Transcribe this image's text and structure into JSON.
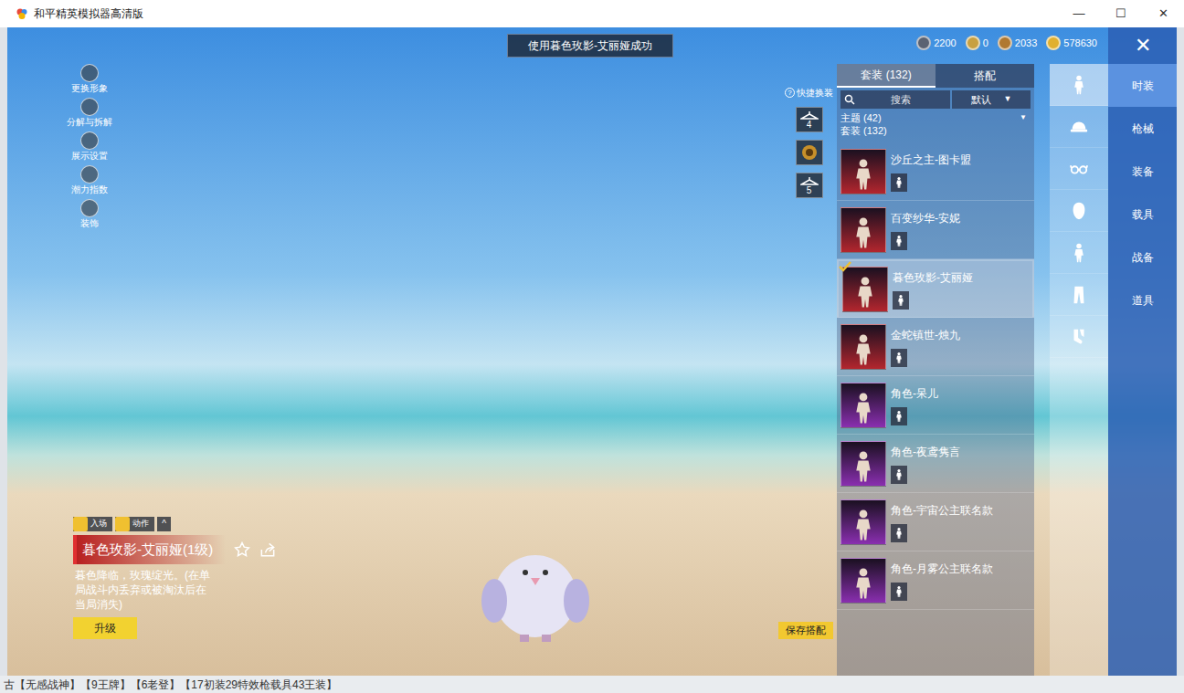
{
  "window": {
    "title": "和平精英模拟器高清版",
    "controls": [
      "—",
      "☐",
      "✕"
    ]
  },
  "toast": "使用暮色玫影-艾丽娅成功",
  "currencies": [
    {
      "amount": "2200",
      "color": "#5a6272"
    },
    {
      "amount": "0",
      "color": "#c8a040"
    },
    {
      "amount": "2033",
      "color": "#b07830"
    },
    {
      "amount": "578630",
      "color": "#e0b030"
    }
  ],
  "close_button": "✕",
  "side_menu": [
    "更换形象",
    "分解与拆解",
    "展示设置",
    "潮力指数",
    "装饰"
  ],
  "quick_change": {
    "help": "?",
    "label": "快捷换装",
    "slots": [
      {
        "kind": "hanger",
        "number": "4"
      },
      {
        "kind": "badge",
        "number": ""
      },
      {
        "kind": "hanger",
        "number": "5"
      }
    ]
  },
  "item_info": {
    "tabs": [
      {
        "label": "入场",
        "selected": false
      },
      {
        "label": "动作",
        "selected": false
      }
    ],
    "collapse": "^",
    "title": "暮色玫影-艾丽娅(1级)",
    "description": "暮色降临，玫瑰绽光。(在单局战斗内丢弃或被淘汰后在当局消失)",
    "upgrade_button": "升级"
  },
  "save_button": "保存搭配",
  "panel": {
    "tabs": [
      {
        "label": "套装 (132)",
        "selected": true
      },
      {
        "label": "搭配",
        "selected": false
      }
    ],
    "search": {
      "placeholder": "搜索"
    },
    "sort": {
      "value": "默认",
      "arrow": "▼"
    },
    "filter": {
      "label": "主题 (42)",
      "arrow": "▼"
    },
    "section": "套装 (132)",
    "items": [
      {
        "name": "沙丘之主-图卡盟",
        "selected": false,
        "color": "#b3262e"
      },
      {
        "name": "百变纱华-安妮",
        "selected": false,
        "color": "#b3262e"
      },
      {
        "name": "暮色玫影-艾丽娅",
        "selected": true,
        "color": "#b3262e"
      },
      {
        "name": "金蛇镇世-烛九",
        "selected": false,
        "color": "#b3262e"
      },
      {
        "name": "角色-呆儿",
        "selected": false,
        "color": "#8a2fb0"
      },
      {
        "name": "角色-夜鸢隽言",
        "selected": false,
        "color": "#8a2fb0"
      },
      {
        "name": "角色-宇宙公主联名款",
        "selected": false,
        "color": "#8a2fb0"
      },
      {
        "name": "角色-月雾公主联名款",
        "selected": false,
        "color": "#8a2fb0"
      }
    ]
  },
  "category_icons": [
    {
      "kind": "outfit",
      "selected": true
    },
    {
      "kind": "hat",
      "selected": false
    },
    {
      "kind": "glasses",
      "selected": false
    },
    {
      "kind": "head",
      "selected": false
    },
    {
      "kind": "figure",
      "selected": false
    },
    {
      "kind": "pants",
      "selected": false
    },
    {
      "kind": "socks",
      "selected": false
    }
  ],
  "categories": [
    {
      "label": "时装",
      "selected": true
    },
    {
      "label": "枪械",
      "selected": false
    },
    {
      "label": "装备",
      "selected": false
    },
    {
      "label": "载具",
      "selected": false
    },
    {
      "label": "战备",
      "selected": false
    },
    {
      "label": "道具",
      "selected": false
    }
  ],
  "background_strip": "古【无感战神】【9王牌】【6老登】【17初装29特效枪载具43王装】"
}
